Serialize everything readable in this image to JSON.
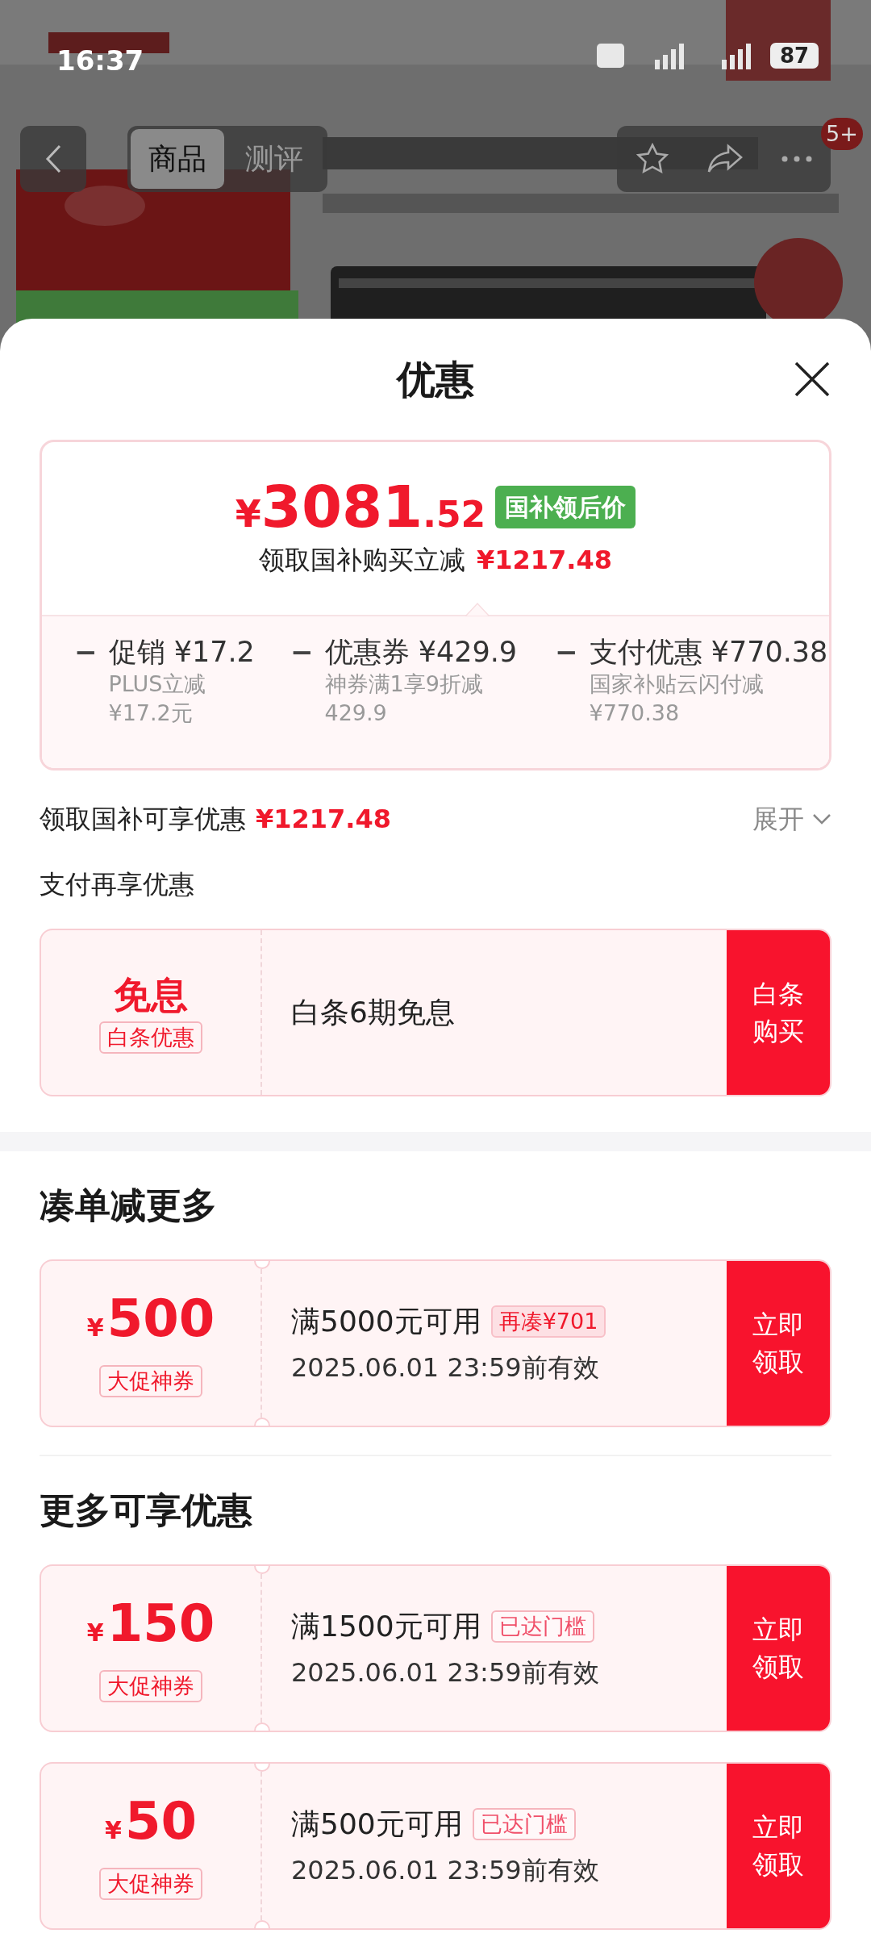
{
  "status_bar": {
    "time": "16:37",
    "battery": "87"
  },
  "nav": {
    "tabs": [
      {
        "label": "商品",
        "selected": true
      },
      {
        "label": "测评",
        "selected": false
      }
    ],
    "badge": "5+"
  },
  "sheet": {
    "title": "优惠"
  },
  "price_card": {
    "currency": "¥",
    "integer": "3081",
    "decimal": ".52",
    "tag": "国补领后价",
    "subtitle": "领取国补购买立减",
    "subtitle_amount": "¥1217.48",
    "breakdown": [
      {
        "operator": "−",
        "title": "促销 ¥17.2",
        "desc_lines": [
          "PLUS立减",
          "¥17.2元"
        ]
      },
      {
        "operator": "−",
        "title": "优惠券 ¥429.9",
        "desc_lines": [
          "神券满1享9折减",
          "429.9"
        ]
      },
      {
        "operator": "−",
        "title": "支付优惠 ¥770.38",
        "desc_lines": [
          "国家补贴云闪付减",
          "¥770.38"
        ]
      }
    ]
  },
  "summary": {
    "label": "领取国补可享优惠",
    "amount": "¥1217.48",
    "expand": "展开"
  },
  "payment_section": {
    "title": "支付再享优惠",
    "offer": {
      "left_title": "免息",
      "left_tag": "白条优惠",
      "text": "白条6期免息",
      "button": "白条购买"
    }
  },
  "sections": [
    {
      "title": "凑单减更多",
      "coupons": [
        {
          "currency": "¥",
          "amount": "500",
          "tag": "大促神券",
          "condition": "满5000元可用",
          "badge": {
            "text": "再凑¥701",
            "kind": "add_more"
          },
          "validity": "2025.06.01 23:59前有效",
          "button": "立即领取"
        }
      ]
    },
    {
      "title": "更多可享优惠",
      "coupons": [
        {
          "currency": "¥",
          "amount": "150",
          "tag": "大促神券",
          "condition": "满1500元可用",
          "badge": {
            "text": "已达门槛",
            "kind": "reached"
          },
          "validity": "2025.06.01 23:59前有效",
          "button": "立即领取"
        },
        {
          "currency": "¥",
          "amount": "50",
          "tag": "大促神券",
          "condition": "满500元可用",
          "badge": {
            "text": "已达门槛",
            "kind": "reached"
          },
          "validity": "2025.06.01 23:59前有效",
          "button": "立即领取"
        }
      ]
    }
  ]
}
